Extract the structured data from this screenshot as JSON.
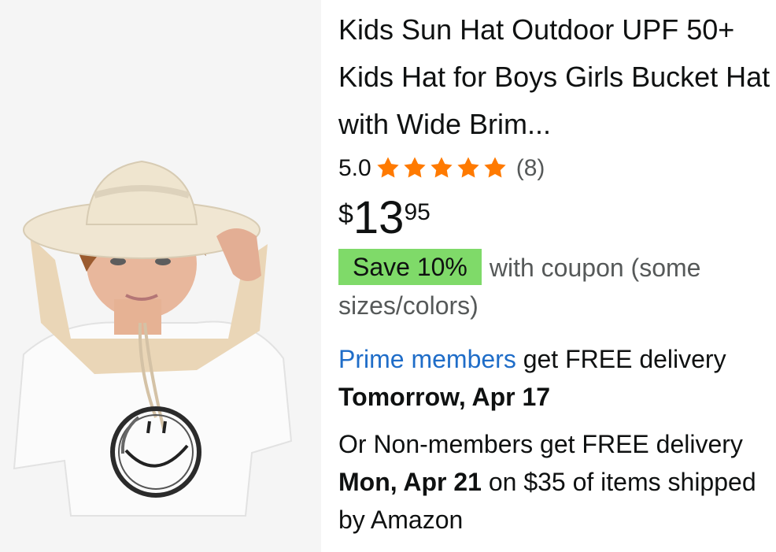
{
  "product": {
    "image_alt": "child wearing beige sun hat with neck flap",
    "title": "Kids Sun Hat Outdoor UPF 50+ Kids Hat for Boys Girls Bucket Hat with Wide Brim...",
    "rating": "5.0",
    "rating_stars": 5,
    "rating_count": "(8)",
    "price": {
      "symbol": "$",
      "whole": "13",
      "fraction": "95"
    },
    "coupon": {
      "badge": "Save 10%",
      "text": "with coupon (some sizes/colors)"
    },
    "delivery": {
      "prime_link": "Prime members",
      "prime_text": " get FREE delivery",
      "prime_date": "Tomorrow, Apr 17",
      "nonmember_prefix": "Or Non-members get FREE delivery ",
      "nonmember_date": "Mon, Apr 21",
      "nonmember_suffix": " on $35 of items shipped by Amazon"
    }
  },
  "colors": {
    "star": "#ff7a00",
    "coupon_bg": "#7fda69",
    "link": "#1f6dc8"
  }
}
